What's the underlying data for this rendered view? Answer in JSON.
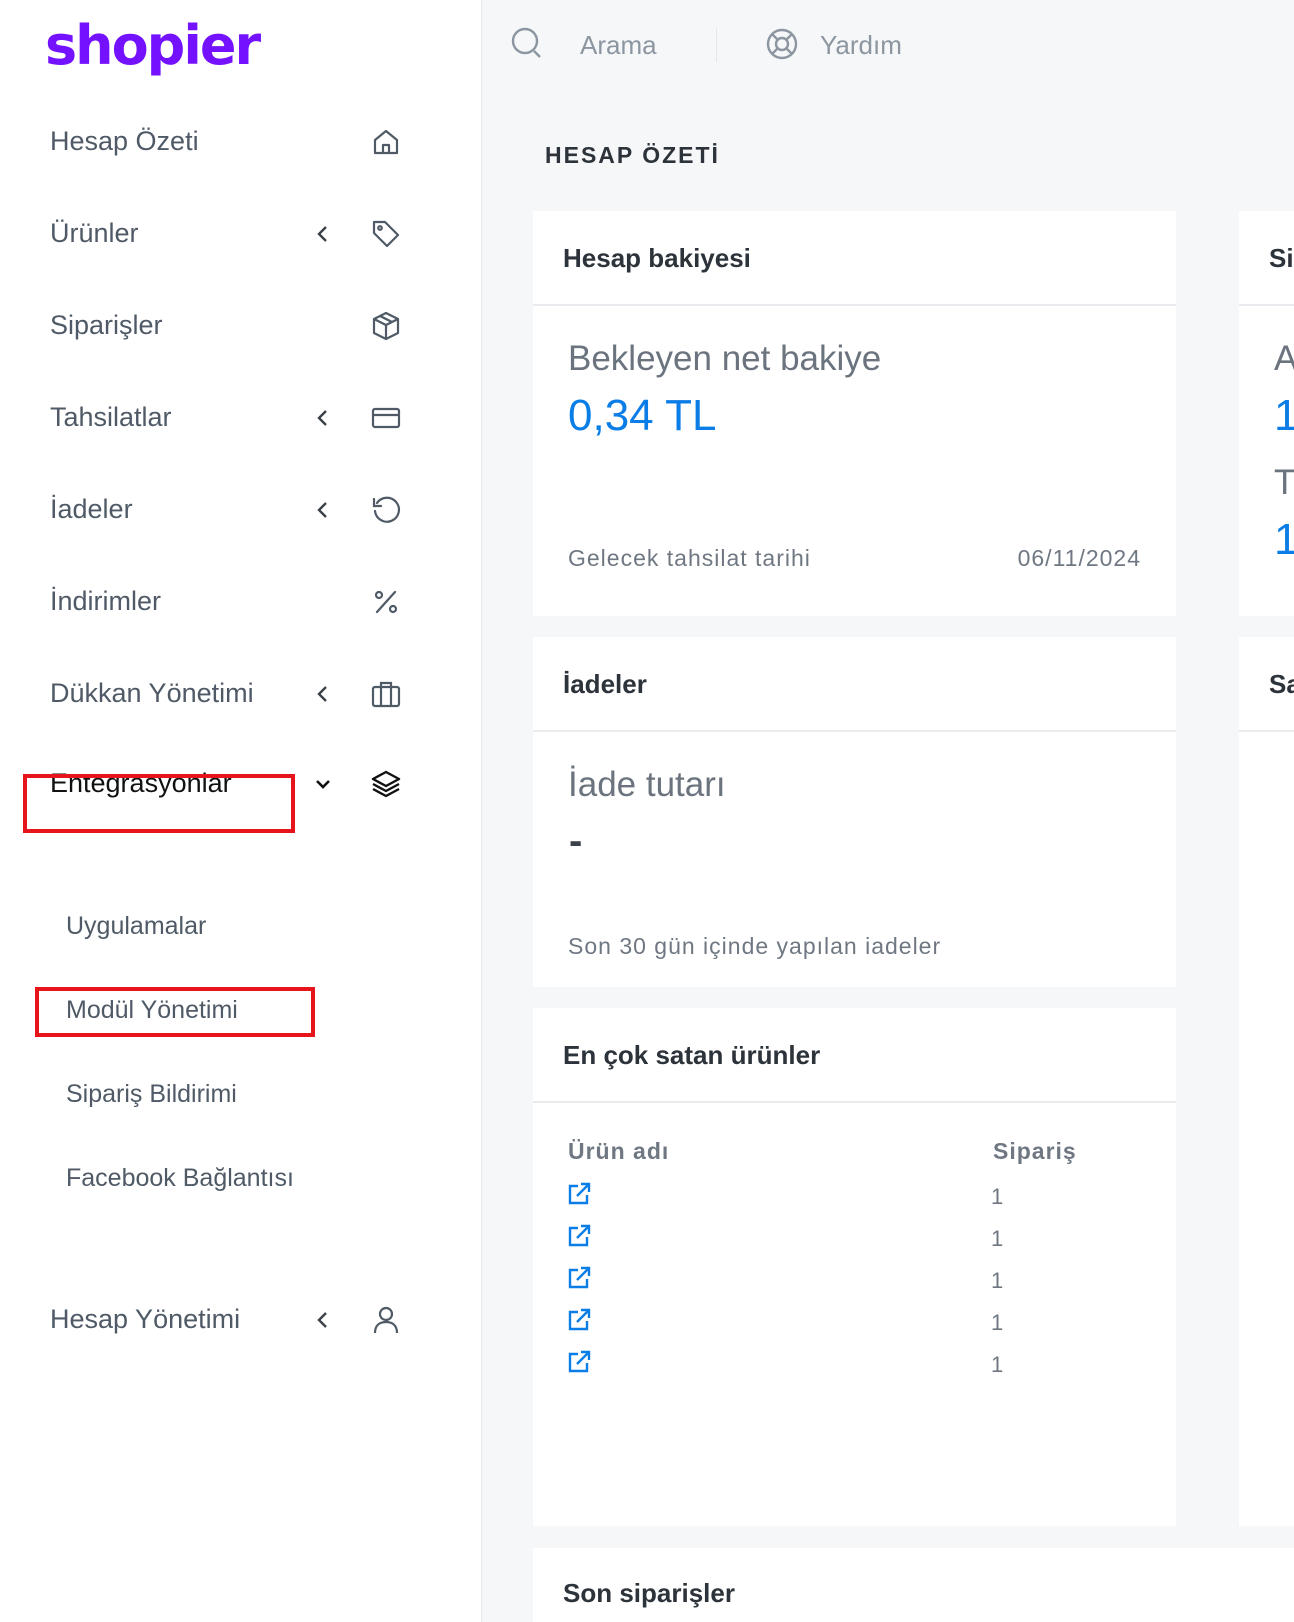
{
  "brand": {
    "logo": "shopier",
    "color": "#7412ff"
  },
  "sidebar": {
    "items": [
      {
        "label": "Hesap Özeti",
        "icon": "home-icon"
      },
      {
        "label": "Ürünler",
        "icon": "tag-icon",
        "has_chevron": true
      },
      {
        "label": "Siparişler",
        "icon": "box-icon"
      },
      {
        "label": "Tahsilatlar",
        "icon": "credit-card-icon",
        "has_chevron": true
      },
      {
        "label": "İadeler",
        "icon": "undo-icon",
        "has_chevron": true
      },
      {
        "label": "İndirimler",
        "icon": "percent-icon"
      },
      {
        "label": "Dükkan Yönetimi",
        "icon": "briefcase-icon",
        "has_chevron": true
      },
      {
        "label": "Entegrasyonlar",
        "icon": "layers-icon",
        "expanded": true
      },
      {
        "label": "Hesap Yönetimi",
        "icon": "user-icon",
        "has_chevron": true
      }
    ],
    "submenu": [
      "Uygulamalar",
      "Modül Yönetimi",
      "Sipariş Bildirimi",
      "Facebook Bağlantısı"
    ]
  },
  "topbar": {
    "search_label": "Arama",
    "help_label": "Yardım"
  },
  "page_title": "HESAP ÖZETİ",
  "balance_card": {
    "title": "Hesap bakiyesi",
    "label": "Bekleyen net bakiye",
    "value": "0,34 TL",
    "footer_label": "Gelecek tahsilat tarihi",
    "footer_date": "06/11/2024"
  },
  "refunds_card": {
    "title": "İadeler",
    "label": "İade tutarı",
    "value": "-",
    "footer": "Son 30 gün içinde yapılan iadeler"
  },
  "bestsellers_card": {
    "title": "En çok satan ürünler",
    "col_product": "Ürün adı",
    "col_orders": "Sipariş",
    "rows": [
      "1",
      "1",
      "1",
      "1",
      "1"
    ]
  },
  "recent_orders_card": {
    "title": "Son siparişler"
  },
  "right_cards": {
    "top_title_clip": "Si",
    "line1": "A",
    "value1": "1",
    "line2": "T",
    "value2": "1",
    "second_title_clip": "Sa"
  },
  "colors": {
    "accent_blue": "#0a7ee6",
    "highlight_red": "#e8141c"
  }
}
